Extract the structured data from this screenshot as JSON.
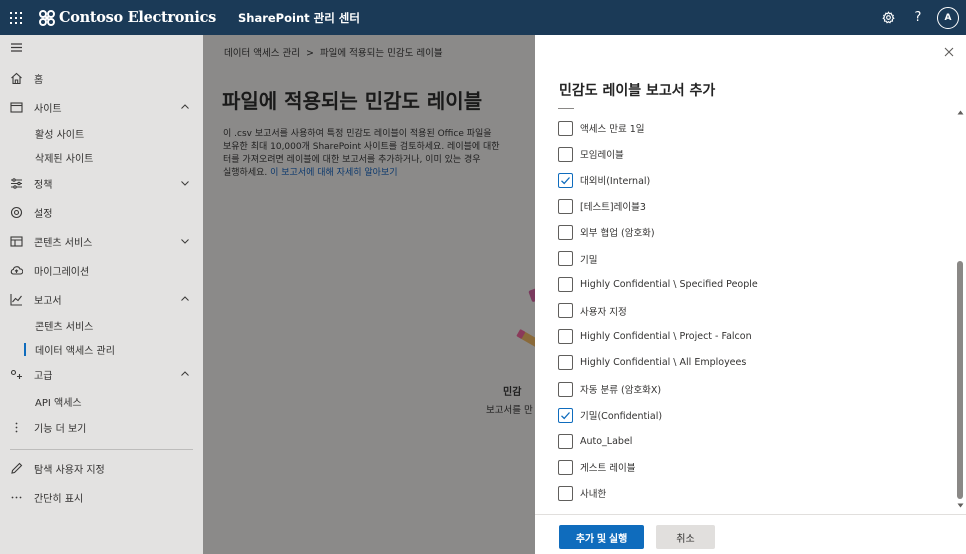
{
  "topbar": {
    "brand": "Contoso Electronics",
    "app_title": "SharePoint 관리 센터",
    "avatar_initial": "A",
    "help_glyph": "?"
  },
  "nav": {
    "items": [
      {
        "label": "홈",
        "icon": "home-icon"
      },
      {
        "label": "사이트",
        "icon": "sites-icon",
        "expanded": true
      },
      {
        "label": "활성 사이트"
      },
      {
        "label": "삭제된 사이트"
      },
      {
        "label": "정책",
        "icon": "policies-icon",
        "expanded": false
      },
      {
        "label": "설정",
        "icon": "settings-icon"
      },
      {
        "label": "콘텐츠 서비스",
        "icon": "content-services-icon",
        "expanded": false
      },
      {
        "label": "마이그레이션",
        "icon": "migration-icon"
      },
      {
        "label": "보고서",
        "icon": "reports-icon",
        "expanded": true
      },
      {
        "label": "콘텐츠 서비스"
      },
      {
        "label": "데이터 액세스 관리",
        "selected": true
      },
      {
        "label": "고급",
        "icon": "advanced-icon",
        "expanded": true
      },
      {
        "label": "API 액세스"
      },
      {
        "label": "기능 더 보기",
        "icon": "more-features-icon"
      },
      {
        "label": "탐색 사용자 지정",
        "icon": "customize-nav-icon"
      },
      {
        "label": "간단히 표시",
        "icon": "show-less-icon"
      }
    ]
  },
  "main": {
    "breadcrumb": [
      "데이터 액세스 관리",
      "파일에 적용되는 민감도 레이블"
    ],
    "breadcrumb_sep": ">",
    "title": "파일에 적용되는 민감도 레이블",
    "description": [
      "이 .csv 보고서를 사용하여 특정 민감도 레이블이 적용된 Office 파일을",
      "보유한 최대 10,000개 SharePoint 사이트를 검토하세요. 레이블에 대한",
      "터를 가져오려면 레이블에 대한 보고서를 추가하거나, 이미 있는 경우",
      "실행하세요."
    ],
    "learn_more_link": "이 보고서에 대해 자세히 알아보기",
    "empty_title": "민감",
    "empty_sub": "보고서를 만"
  },
  "panel": {
    "title": "민감도 레이블 보고서 추가",
    "items": [
      {
        "label": "액세스 만료 1일",
        "checked": false
      },
      {
        "label": "모임레이블",
        "checked": false
      },
      {
        "label": "대외비(Internal)",
        "checked": true
      },
      {
        "label": "[테스트]레이블3",
        "checked": false
      },
      {
        "label": "외부 협업 (암호화)",
        "checked": false
      },
      {
        "label": "기밀",
        "checked": false
      },
      {
        "label": "Highly Confidential \\ Specified People",
        "checked": false
      },
      {
        "label": "사용자 지정",
        "checked": false
      },
      {
        "label": "Highly Confidential \\ Project - Falcon",
        "checked": false
      },
      {
        "label": "Highly Confidential \\ All Employees",
        "checked": false
      },
      {
        "label": "자동 분류 (암호화X)",
        "checked": false
      },
      {
        "label": "기밀(Confidential)",
        "checked": true
      },
      {
        "label": "Auto_Label",
        "checked": false
      },
      {
        "label": "게스트 레이블",
        "checked": false
      },
      {
        "label": "사내한",
        "checked": false
      }
    ],
    "primary_button": "추가 및 실행",
    "secondary_button": "취소"
  },
  "colors": {
    "topbar": "#1b3a57",
    "accent": "#0f6cbd",
    "nav_bg": "#e3e2e1",
    "overlay": "#8b8a89"
  }
}
